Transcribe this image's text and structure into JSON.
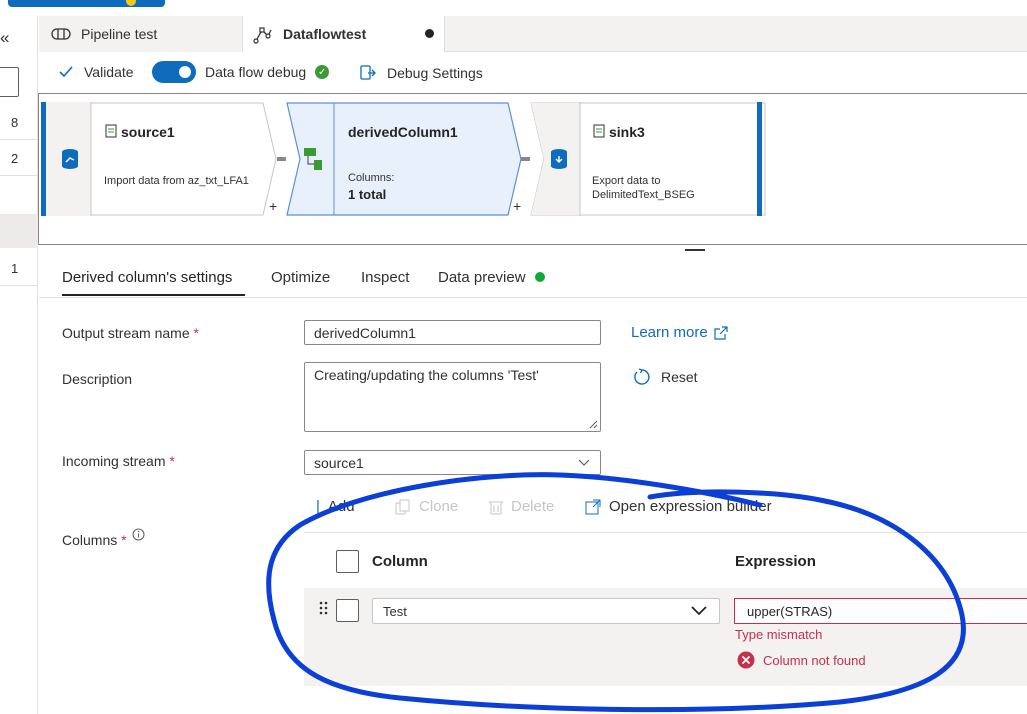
{
  "window": {
    "tabs": [
      {
        "label": "Pipeline test",
        "icon": "pipeline-icon",
        "active": false
      },
      {
        "label": "Dataflowtest",
        "icon": "dataflow-icon",
        "active": true,
        "unsaved": true
      }
    ]
  },
  "left_rail": {
    "collapse_icon": "«",
    "numbers": [
      "8",
      "2",
      "1"
    ]
  },
  "toolbar": {
    "validate_label": "Validate",
    "debug_label": "Data flow debug",
    "debug_on": true,
    "debug_settings_label": "Debug Settings"
  },
  "canvas": {
    "nodes": [
      {
        "title": "source1",
        "subtitle": "Import data from az_txt_LFA1"
      },
      {
        "title": "derivedColumn1",
        "columns_label": "Columns:",
        "columns_value": "1 total",
        "selected": true
      },
      {
        "title": "sink3",
        "subtitle_line1": "Export data to",
        "subtitle_line2": "DelimitedText_BSEG"
      }
    ],
    "plus": "+"
  },
  "settings_tabs": [
    {
      "label": "Derived column's settings",
      "active": true
    },
    {
      "label": "Optimize"
    },
    {
      "label": "Inspect"
    },
    {
      "label": "Data preview",
      "status_dot": true
    }
  ],
  "form": {
    "output_stream_label": "Output stream name",
    "output_stream_value": "derivedColumn1",
    "description_label": "Description",
    "description_value": "Creating/updating the columns 'Test'",
    "incoming_stream_label": "Incoming stream",
    "incoming_stream_value": "source1",
    "columns_label": "Columns",
    "required_mark": "*",
    "learn_more": "Learn more",
    "reset": "Reset"
  },
  "columns_toolbar": {
    "add": "Add",
    "clone": "Clone",
    "delete": "Delete",
    "open_builder": "Open expression builder"
  },
  "columns_table": {
    "headers": {
      "column": "Column",
      "expression": "Expression"
    },
    "rows": [
      {
        "column": "Test",
        "expression": "upper(STRAS)",
        "error_type": "Type mismatch",
        "error_detail": "Column not found"
      }
    ]
  },
  "colors": {
    "accent": "#0f6cbd",
    "error": "#c4314b",
    "success": "#3a9b34",
    "annotation": "#0b3fd6"
  }
}
